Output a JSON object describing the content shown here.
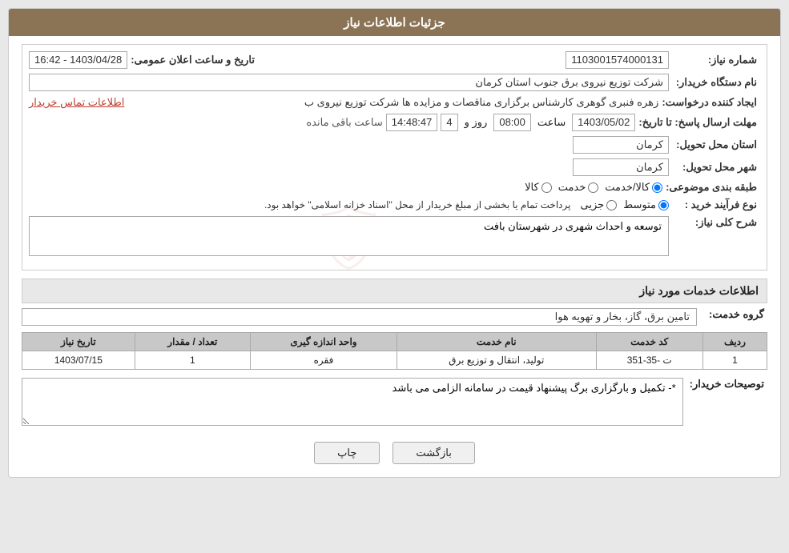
{
  "header": {
    "title": "جزئیات اطلاعات نیاز"
  },
  "info": {
    "shomara_niaz_label": "شماره نیاز:",
    "shomara_niaz_value": "1103001574000131",
    "tarikh_label": "تاریخ و ساعت اعلان عمومی:",
    "tarikh_value": "1403/04/28 - 16:42",
    "nam_dastgah_label": "نام دستگاه خریدار:",
    "nam_dastgah_value": "شرکت توزیع نیروی برق جنوب استان کرمان",
    "ijad_konande_label": "ایجاد کننده درخواست:",
    "ijad_konande_value": "زهره فنبری گوهری کارشناس برگزاری مناقصات و مزایده ها شرکت توزیع نیروی ب",
    "ijad_konande_link": "اطلاعات تماس خریدار",
    "mohlat_label": "مهلت ارسال پاسخ: تا تاریخ:",
    "mohlat_date": "1403/05/02",
    "mohlat_saat": "08:00",
    "mohlat_roz": "4",
    "mohlat_time": "14:48:47",
    "mohlat_remaining": "ساعت باقی مانده",
    "ostan_label": "استان محل تحویل:",
    "ostan_value": "کرمان",
    "shahr_label": "شهر محل تحویل:",
    "shahr_value": "کرمان",
    "tabaqe_label": "طبقه بندی موضوعی:",
    "radio_kala": "کالا",
    "radio_khedmat": "خدمت",
    "radio_kala_khedmat": "کالا/خدمت",
    "radio_kala_checked": false,
    "radio_khedmat_checked": false,
    "radio_kala_khedmat_checked": true,
    "nav_farAyand_label": "نوع فرآیند خرید :",
    "radio_jozei": "جزیی",
    "radio_motevaset": "متوسط",
    "nav_description": "پرداخت تمام یا بخشی از مبلغ خریدار از محل \"اسناد خزانه اسلامی\" خواهد بود.",
    "sharh_label": "شرح کلی نیاز:",
    "sharh_value": "توسعه و احداث شهری در شهرستان بافت",
    "services_section_header": "اطلاعات خدمات مورد نیاز",
    "grouh_khedmat_label": "گروه خدمت:",
    "grouh_khedmat_value": "تامین برق، گاز، بخار و تهویه هوا",
    "table_headers": [
      "ردیف",
      "کد خدمت",
      "نام خدمت",
      "واحد اندازه گیری",
      "تعداد / مقدار",
      "تاریخ نیاز"
    ],
    "table_rows": [
      [
        "1",
        "ت -35-351",
        "تولید، انتقال و توزیع برق",
        "فقره",
        "1",
        "1403/07/15"
      ]
    ],
    "tosiyeh_label": "توصیحات خریدار:",
    "tosiyeh_value": "*- تکمیل و بارگزاری برگ پیشنهاد قیمت در سامانه الزامی می باشد",
    "btn_print": "چاپ",
    "btn_back": "بازگشت"
  }
}
